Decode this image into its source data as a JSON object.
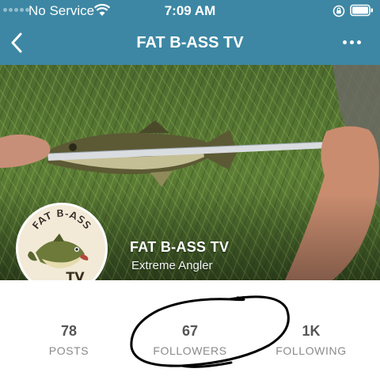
{
  "status_bar": {
    "carrier": "No Service",
    "time": "7:09 AM"
  },
  "nav": {
    "title": "FAT B-ASS TV"
  },
  "profile": {
    "name": "FAT B-ASS TV",
    "subtitle": "Extreme Angler",
    "avatar_text_top": "FAT B-ASS",
    "avatar_text_bottom": "TV"
  },
  "stats": [
    {
      "value": "78",
      "label": "POSTS"
    },
    {
      "value": "67",
      "label": "FOLLOWERS"
    },
    {
      "value": "1K",
      "label": "FOLLOWING"
    }
  ],
  "icons": {
    "back": "chevron-left-icon",
    "more": "ellipsis-icon",
    "wifi": "wifi-icon",
    "lock": "orientation-lock-icon",
    "battery": "battery-icon"
  },
  "colors": {
    "header_bg": "#3d87a4",
    "text_white": "#ffffff",
    "stat_value": "#555555",
    "stat_label": "#8a8a8a",
    "annotation": "#000000"
  }
}
